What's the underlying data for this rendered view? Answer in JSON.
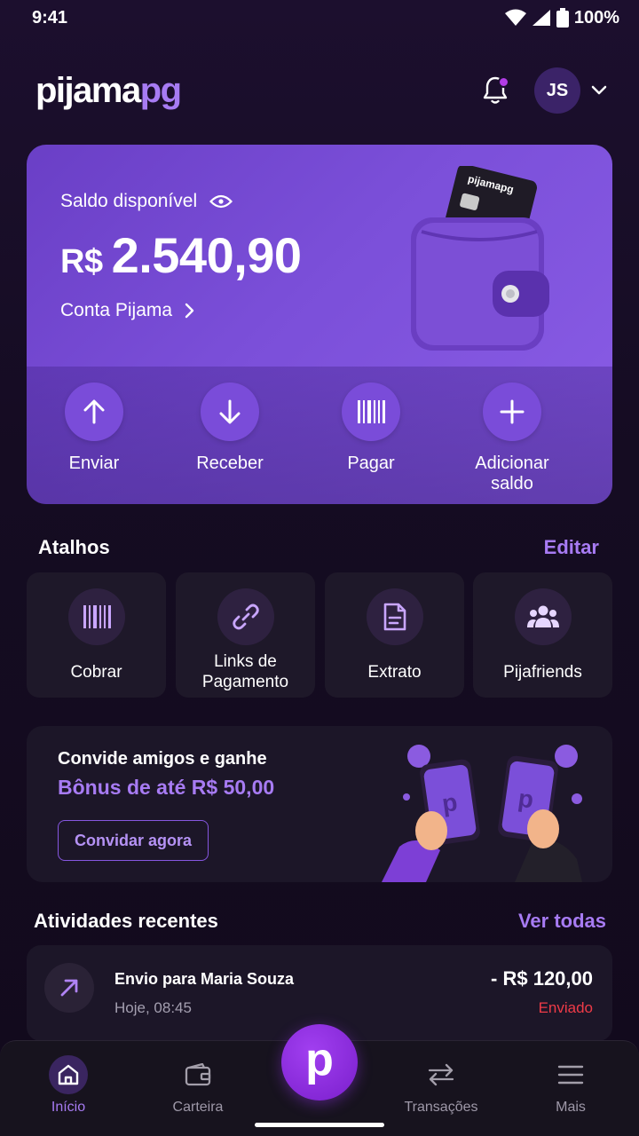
{
  "status_bar": {
    "time": "9:41",
    "battery": "100%"
  },
  "header": {
    "logo_main": "pijama",
    "logo_accent": "pg",
    "avatar_initials": "JS"
  },
  "balance": {
    "label": "Saldo disponível",
    "currency": "R$",
    "amount": "2.540,90",
    "account_link": "Conta Pijama",
    "card_brand": "pijamapg"
  },
  "actions": [
    {
      "label": "Enviar",
      "icon": "arrow-up-icon"
    },
    {
      "label": "Receber",
      "icon": "arrow-down-icon"
    },
    {
      "label": "Pagar",
      "icon": "barcode-icon"
    },
    {
      "label": "Adicionar saldo",
      "icon": "plus-icon"
    }
  ],
  "shortcuts_section": {
    "title": "Atalhos",
    "edit_label": "Editar"
  },
  "shortcuts": [
    {
      "label": "Cobrar",
      "icon": "barcode-icon"
    },
    {
      "label": "Links de Pagamento",
      "icon": "link-icon"
    },
    {
      "label": "Extrato",
      "icon": "document-icon"
    },
    {
      "label": "Pijafriends",
      "icon": "group-icon"
    }
  ],
  "invite": {
    "title": "Convide amigos e ganhe",
    "bonus": "Bônus de até R$ 50,00",
    "button_label": "Convidar agora"
  },
  "activities_section": {
    "title": "Atividades recentes",
    "see_all_label": "Ver todas"
  },
  "activities": [
    {
      "title": "Envio para Maria Souza",
      "time": "Hoje, 08:45",
      "amount": "- R$ 120,00",
      "status": "Enviado",
      "icon": "arrow-up-right-icon"
    }
  ],
  "bottom_nav": {
    "items": [
      {
        "label": "Início",
        "icon": "home-icon",
        "active": true
      },
      {
        "label": "Carteira",
        "icon": "wallet-icon",
        "active": false
      },
      {
        "label": "Transações",
        "icon": "transfer-icon",
        "active": false
      },
      {
        "label": "Mais",
        "icon": "menu-icon",
        "active": false
      }
    ],
    "center_button_letter": "p"
  },
  "colors": {
    "accent": "#a77bf3",
    "card_purple": "#7b4fd9",
    "negative_status": "#ef3b48",
    "fab": "#8f2ee0"
  }
}
